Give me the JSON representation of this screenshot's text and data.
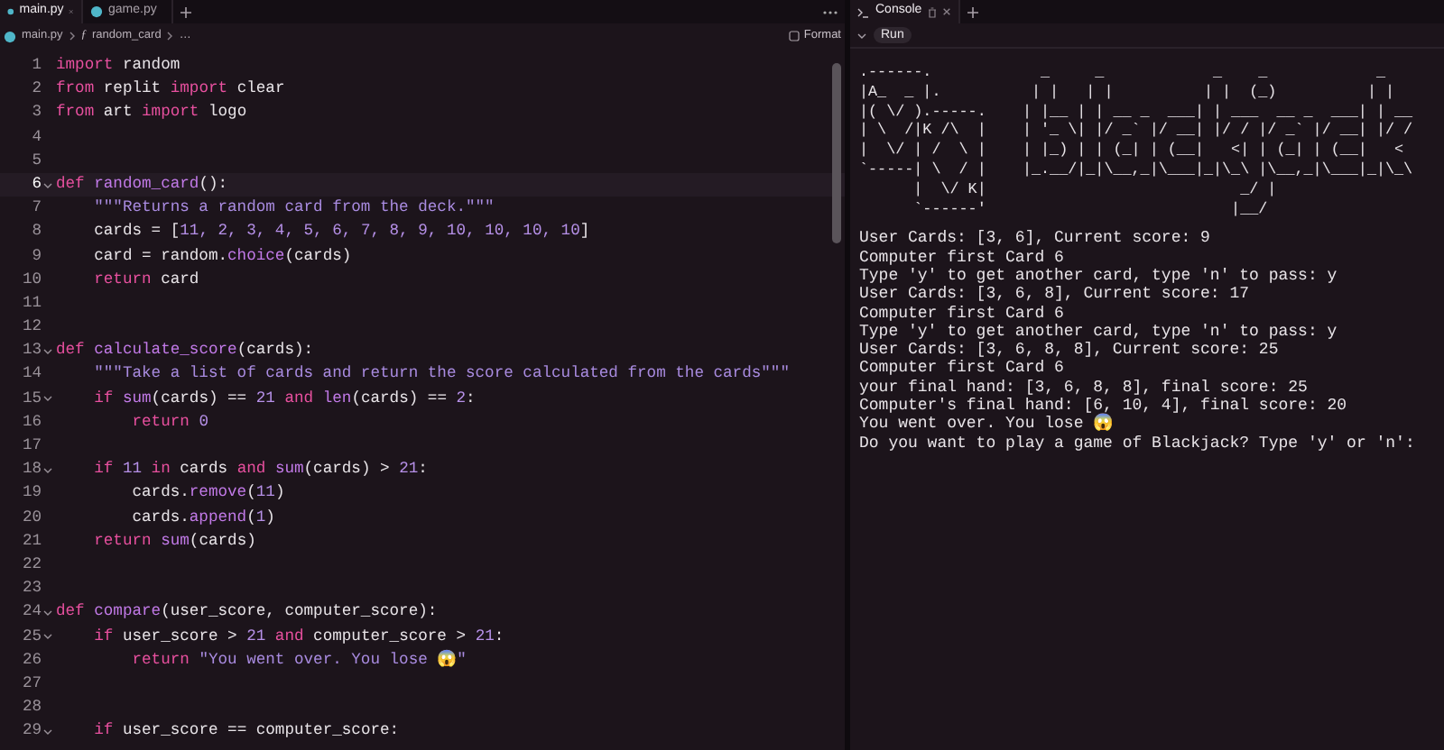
{
  "editor": {
    "tabs": [
      {
        "label": "main.py",
        "selected": true
      },
      {
        "label": "game.py",
        "selected": false
      }
    ],
    "breadcrumb": [
      {
        "label": "main.py"
      },
      {
        "glyph": "ƒ",
        "label": "random_card"
      },
      {
        "label": "…"
      }
    ],
    "format_button": "Format",
    "lines": [
      {
        "number": "1",
        "foldable": false,
        "current": false,
        "tokens": [
          {
            "kind": "kw",
            "text": "import"
          },
          {
            "kind": "plain",
            "text": " random"
          }
        ]
      },
      {
        "number": "2",
        "foldable": false,
        "current": false,
        "tokens": [
          {
            "kind": "kw",
            "text": "from"
          },
          {
            "kind": "plain",
            "text": " replit "
          },
          {
            "kind": "kw",
            "text": "import"
          },
          {
            "kind": "plain",
            "text": " clear"
          }
        ]
      },
      {
        "number": "3",
        "foldable": false,
        "current": false,
        "tokens": [
          {
            "kind": "kw",
            "text": "from"
          },
          {
            "kind": "plain",
            "text": " art "
          },
          {
            "kind": "kw",
            "text": "import"
          },
          {
            "kind": "plain",
            "text": " logo"
          }
        ]
      },
      {
        "number": "4",
        "foldable": false,
        "current": false
      },
      {
        "number": "5",
        "foldable": false,
        "current": false
      },
      {
        "number": "6",
        "foldable": true,
        "current": true,
        "tokens": [
          {
            "kind": "kw",
            "text": "def "
          },
          {
            "kind": "fn",
            "text": "random_card"
          },
          {
            "kind": "plain",
            "text": "():"
          }
        ]
      },
      {
        "number": "7",
        "foldable": false,
        "current": false,
        "tokens": [
          {
            "kind": "str",
            "text": "    \"\"\"Returns a random card from the deck.\"\"\""
          }
        ]
      },
      {
        "number": "8",
        "foldable": false,
        "current": false,
        "tokens": [
          {
            "kind": "plain",
            "text": "    cards = ["
          },
          {
            "kind": "num",
            "text": "11, 2, 3, 4, 5, 6, 7, 8, 9, 10, 10, 10, 10"
          },
          {
            "kind": "plain",
            "text": "]"
          }
        ]
      },
      {
        "number": "9",
        "foldable": false,
        "current": false,
        "tokens": [
          {
            "kind": "plain",
            "text": "    card = random."
          },
          {
            "kind": "fn",
            "text": "choice"
          },
          {
            "kind": "plain",
            "text": "(cards)"
          }
        ]
      },
      {
        "number": "10",
        "foldable": false,
        "current": false,
        "tokens": [
          {
            "kind": "kw",
            "text": "    return"
          },
          {
            "kind": "plain",
            "text": " card"
          }
        ]
      },
      {
        "number": "11",
        "foldable": false,
        "current": false
      },
      {
        "number": "12",
        "foldable": false,
        "current": false
      },
      {
        "number": "13",
        "foldable": true,
        "current": false,
        "tokens": [
          {
            "kind": "kw",
            "text": "def "
          },
          {
            "kind": "fn",
            "text": "calculate_score"
          },
          {
            "kind": "plain",
            "text": "(cards):"
          }
        ]
      },
      {
        "number": "14",
        "foldable": false,
        "current": false,
        "tokens": [
          {
            "kind": "str",
            "text": "    \"\"\"Take a list of cards and return the score calculated from the cards\"\"\""
          }
        ]
      },
      {
        "number": "15",
        "foldable": true,
        "current": false,
        "tokens": [
          {
            "kind": "kw",
            "text": "    if "
          },
          {
            "kind": "fn",
            "text": "sum"
          },
          {
            "kind": "plain",
            "text": "(cards) == "
          },
          {
            "kind": "num",
            "text": "21"
          },
          {
            "kind": "kw",
            "text": " and "
          },
          {
            "kind": "fn",
            "text": "len"
          },
          {
            "kind": "plain",
            "text": "(cards) == "
          },
          {
            "kind": "num",
            "text": "2"
          },
          {
            "kind": "plain",
            "text": ":"
          }
        ]
      },
      {
        "number": "16",
        "foldable": false,
        "current": false,
        "tokens": [
          {
            "kind": "kw",
            "text": "        return "
          },
          {
            "kind": "num",
            "text": "0"
          }
        ]
      },
      {
        "number": "17",
        "foldable": false,
        "current": false
      },
      {
        "number": "18",
        "foldable": true,
        "current": false,
        "tokens": [
          {
            "kind": "kw",
            "text": "    if "
          },
          {
            "kind": "num",
            "text": "11"
          },
          {
            "kind": "kw",
            "text": " in"
          },
          {
            "kind": "plain",
            "text": " cards "
          },
          {
            "kind": "kw",
            "text": "and "
          },
          {
            "kind": "fn",
            "text": "sum"
          },
          {
            "kind": "plain",
            "text": "(cards) > "
          },
          {
            "kind": "num",
            "text": "21"
          },
          {
            "kind": "plain",
            "text": ":"
          }
        ]
      },
      {
        "number": "19",
        "foldable": false,
        "current": false,
        "tokens": [
          {
            "kind": "plain",
            "text": "        cards."
          },
          {
            "kind": "fn",
            "text": "remove"
          },
          {
            "kind": "plain",
            "text": "("
          },
          {
            "kind": "num",
            "text": "11"
          },
          {
            "kind": "plain",
            "text": ")"
          }
        ]
      },
      {
        "number": "20",
        "foldable": false,
        "current": false,
        "tokens": [
          {
            "kind": "plain",
            "text": "        cards."
          },
          {
            "kind": "fn",
            "text": "append"
          },
          {
            "kind": "plain",
            "text": "("
          },
          {
            "kind": "num",
            "text": "1"
          },
          {
            "kind": "plain",
            "text": ")"
          }
        ]
      },
      {
        "number": "21",
        "foldable": false,
        "current": false,
        "tokens": [
          {
            "kind": "kw",
            "text": "    return "
          },
          {
            "kind": "fn",
            "text": "sum"
          },
          {
            "kind": "plain",
            "text": "(cards)"
          }
        ]
      },
      {
        "number": "22",
        "foldable": false,
        "current": false
      },
      {
        "number": "23",
        "foldable": false,
        "current": false
      },
      {
        "number": "24",
        "foldable": true,
        "current": false,
        "tokens": [
          {
            "kind": "kw",
            "text": "def "
          },
          {
            "kind": "fn",
            "text": "compare"
          },
          {
            "kind": "plain",
            "text": "(user_score, computer_score):"
          }
        ]
      },
      {
        "number": "25",
        "foldable": true,
        "current": false,
        "tokens": [
          {
            "kind": "kw",
            "text": "    if"
          },
          {
            "kind": "plain",
            "text": " user_score > "
          },
          {
            "kind": "num",
            "text": "21"
          },
          {
            "kind": "kw",
            "text": " and"
          },
          {
            "kind": "plain",
            "text": " computer_score > "
          },
          {
            "kind": "num",
            "text": "21"
          },
          {
            "kind": "plain",
            "text": ":"
          }
        ]
      },
      {
        "number": "26",
        "foldable": false,
        "current": false,
        "tokens": [
          {
            "kind": "kw",
            "text": "        return "
          },
          {
            "kind": "str",
            "text": "\"You went over. You lose 😱\""
          }
        ]
      },
      {
        "number": "27",
        "foldable": false,
        "current": false
      },
      {
        "number": "28",
        "foldable": false,
        "current": false
      },
      {
        "number": "29",
        "foldable": true,
        "current": false,
        "tokens": [
          {
            "kind": "kw",
            "text": "    if"
          },
          {
            "kind": "plain",
            "text": " user_score == computer_score:"
          }
        ]
      }
    ]
  },
  "console": {
    "tab": "Console",
    "run_button": "Run",
    "logo": [
      ".------.            _     _            _    _            _",
      "|A_  _ |.          | |   | |          | |  (_)          | |",
      "|( \\/ ).-----.    | |__ | | __ _  ___| | ___  __ _  ___| | __",
      "| \\  /|K /\\  |    | '_ \\| |/ _` |/ __| |/ / |/ _` |/ __| |/ /",
      "|  \\/ | /  \\ |    | |_) | | (_| | (__|   <| | (_| | (__|   <",
      "`-----| \\  / |    |_.__/|_|\\__,_|\\___|_|\\_\\ |\\__,_|\\___|_|\\_\\",
      "      |  \\/ K|                            _/ |",
      "      `------'                           |__/"
    ],
    "output": [
      "User Cards: [3, 6], Current score: 9",
      "Computer first Card 6",
      "Type 'y' to get another card, type 'n' to pass: y",
      "User Cards: [3, 6, 8], Current score: 17",
      "Computer first Card 6",
      "Type 'y' to get another card, type 'n' to pass: y",
      "User Cards: [3, 6, 8, 8], Current score: 25",
      "Computer first Card 6",
      "your final hand: [3, 6, 8, 8], final score: 25",
      "Computer's final hand: [6, 10, 4], final score: 20",
      "You went over. You lose 😱",
      "Do you want to play a game of Blackjack? Type 'y' or 'n':"
    ]
  }
}
